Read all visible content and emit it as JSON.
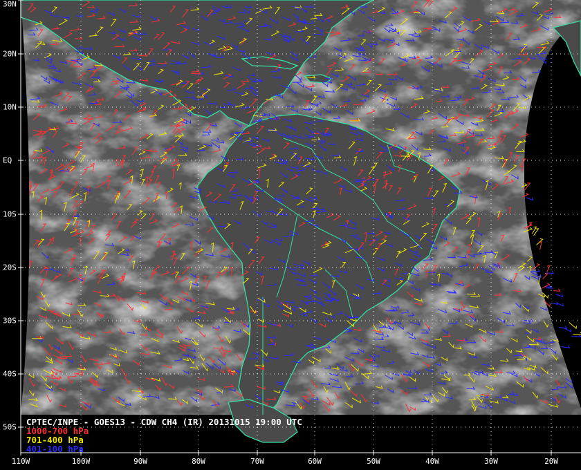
{
  "caption": {
    "title": "CPTEC/INPE - GOES13 - CDW CH4 (IR) 20131015 19:00 UTC"
  },
  "legend": [
    {
      "label": "1000-700 hPa",
      "color": "#ff3030"
    },
    {
      "label": "701-400 hPa",
      "color": "#f2e600"
    },
    {
      "label": "401-100 hPa",
      "color": "#2a2aff"
    }
  ],
  "grid": {
    "lat_labels": [
      "30N",
      "20N",
      "10N",
      "EQ",
      "10S",
      "20S",
      "30S",
      "40S",
      "50S"
    ],
    "lon_labels": [
      "110W",
      "100W",
      "90W",
      "80W",
      "70W",
      "60W",
      "50W",
      "40W",
      "30W",
      "20W"
    ]
  },
  "colors": {
    "coastline": "#33e0a0",
    "grid": "#ffffff",
    "background": "#000000"
  }
}
